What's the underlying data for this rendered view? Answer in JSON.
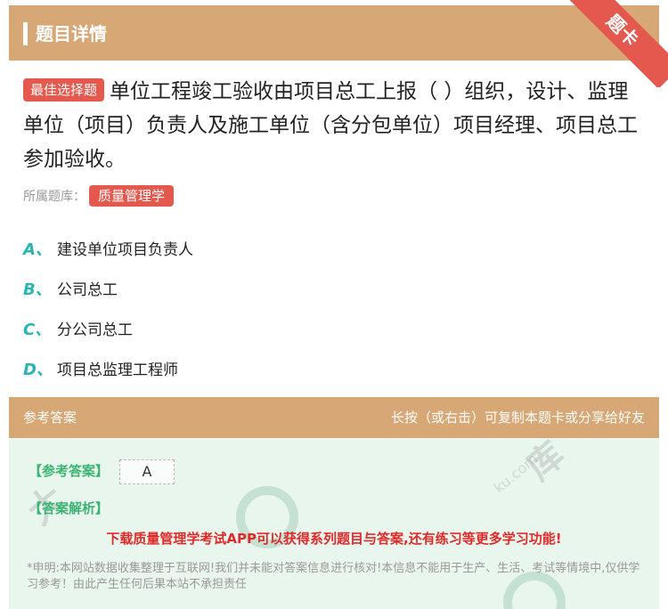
{
  "header": {
    "title": "题目详情",
    "corner": "题卡"
  },
  "question": {
    "type_badge": "最佳选择题",
    "text": "单位工程竣工验收由项目总工上报（ ）组织，设计、监理单位（项目）负责人及施工单位（含分包单位）项目经理、项目总工参加验收。",
    "belong_label": "所属题库：",
    "subject": "质量管理学"
  },
  "options": [
    {
      "letter": "A、",
      "text": "建设单位项目负责人"
    },
    {
      "letter": "B、",
      "text": "公司总工"
    },
    {
      "letter": "C、",
      "text": "分公司总工"
    },
    {
      "letter": "D、",
      "text": "项目总监理工程师"
    }
  ],
  "answer": {
    "section_label": "参考答案",
    "copy_hint": "长按（或右击）可复制本题卡或分享给好友",
    "ref_label": "【参考答案】",
    "ref_value": "A",
    "analysis_label": "【答案解析】",
    "promo": "下载质量管理学考试APP可以获得系列题目与答案,还有练习等更多学习功能!",
    "disclaimer": "*申明:本网站数据收集整理于互联网!我们并未能对答案信息进行核对!本信息不能用于生产、生活、考试等情境中,仅供学习参考！由此产生任何后果本站不承担责任"
  },
  "colors": {
    "header": "#d7a775",
    "accent_red": "#e5584d",
    "option_letter": "#2bb5b0",
    "answer_green": "#3bb371",
    "promo_red": "#e02a2a"
  }
}
